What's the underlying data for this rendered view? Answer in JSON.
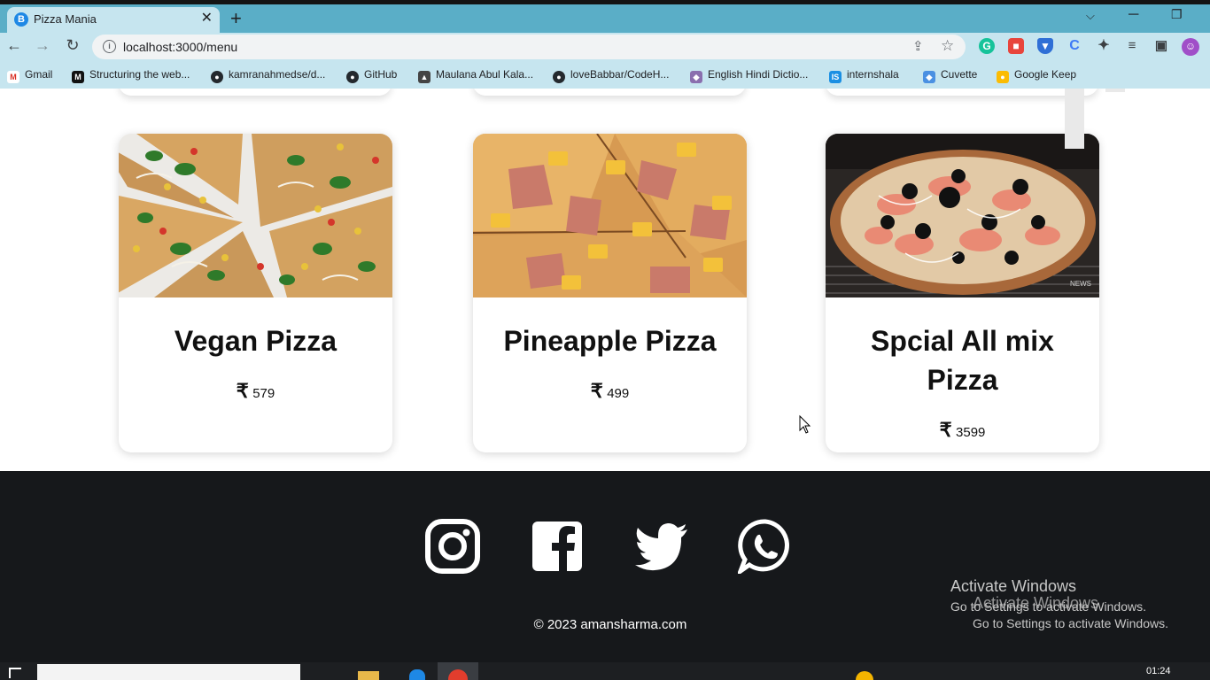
{
  "browser": {
    "tab_title": "Pizza Mania",
    "tab_favicon": "B",
    "tab_close": "✕",
    "new_tab": "+",
    "url": "localhost:3000/menu",
    "bookmarks": [
      {
        "label": "Gmail",
        "icon": "gmail-icon",
        "glyph": "M",
        "color": "#d93025"
      },
      {
        "label": "Structuring the web...",
        "icon": "medium-icon",
        "glyph": "M",
        "color": "#111111"
      },
      {
        "label": "kamranahmedse/d...",
        "icon": "github-icon",
        "glyph": "●",
        "color": "#24292e"
      },
      {
        "label": "GitHub",
        "icon": "github-icon",
        "glyph": "●",
        "color": "#24292e"
      },
      {
        "label": "Maulana Abul Kala...",
        "icon": "graduation-cap-icon",
        "glyph": "▲",
        "color": "#444444"
      },
      {
        "label": "loveBabbar/CodeH...",
        "icon": "github-icon",
        "glyph": "●",
        "color": "#24292e"
      },
      {
        "label": "English Hindi Dictio...",
        "icon": "dictionary-icon",
        "glyph": "◆",
        "color": "#8a6fae"
      },
      {
        "label": "internshala",
        "icon": "internshala-icon",
        "glyph": "IS",
        "color": "#1a8fe3"
      },
      {
        "label": "Cuvette",
        "icon": "cuvette-icon",
        "glyph": "◆",
        "color": "#4a90e2"
      },
      {
        "label": "Google Keep",
        "icon": "google-keep-icon",
        "glyph": "●",
        "color": "#fbbc04"
      }
    ]
  },
  "menu": {
    "currency_symbol": "₹",
    "pizzas": [
      {
        "name": "Vegan Pizza",
        "price": "579"
      },
      {
        "name": "Pineapple Pizza",
        "price": "499"
      },
      {
        "name": "Spcial All mix Pizza",
        "price": "3599"
      }
    ],
    "image_watermark": "NEWS"
  },
  "footer": {
    "copyright": "© 2023 amansharma.com",
    "social": [
      "instagram-icon",
      "facebook-icon",
      "twitter-icon",
      "whatsapp-icon"
    ]
  },
  "overlay": {
    "activate_title": "Activate Windows",
    "activate_sub": "Go to Settings to activate Windows.",
    "activate_title_ghost": "Activate Windows",
    "activate_sub_ghost": "Go to Settings to activate Windows."
  },
  "taskbar": {
    "clock": "01:24"
  },
  "colors": {
    "tab_strip": "#5aaec7",
    "toolbar": "#c6e5ef",
    "footer_bg": "#16181b"
  }
}
